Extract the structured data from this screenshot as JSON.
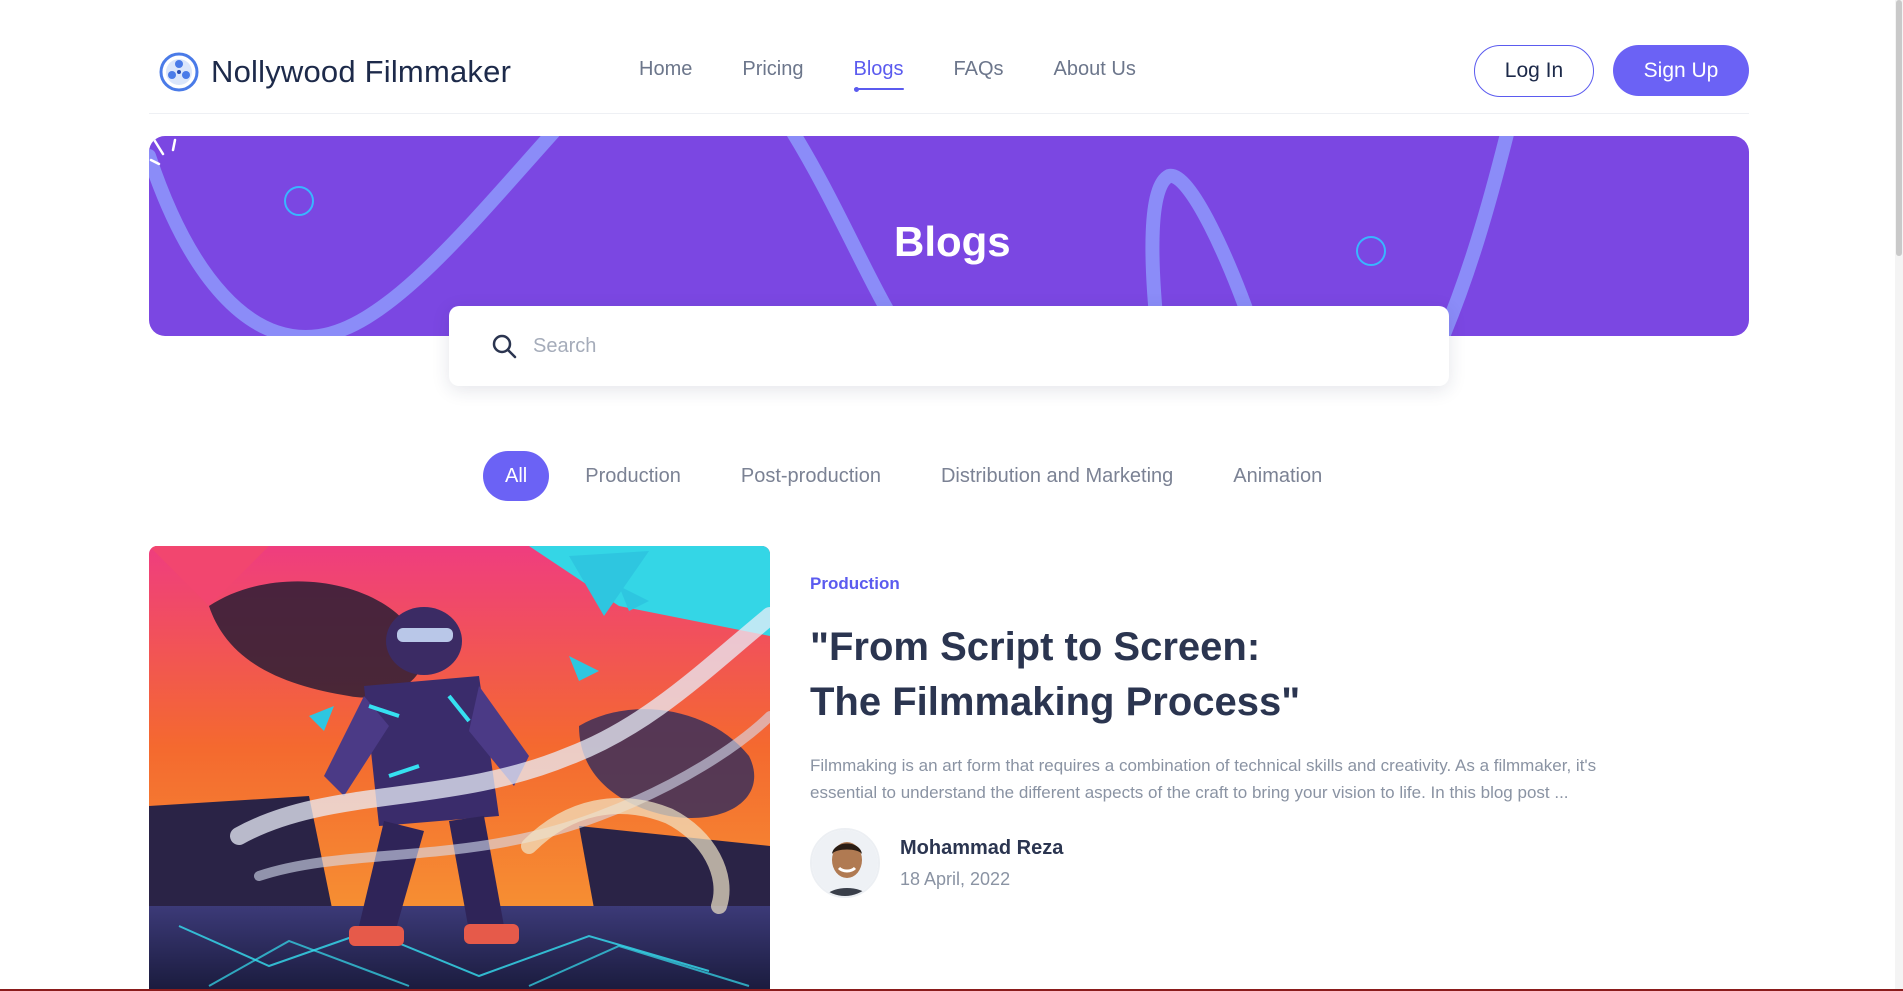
{
  "brand": {
    "name": "Nollywood Filmmaker"
  },
  "nav": {
    "items": [
      {
        "label": "Home"
      },
      {
        "label": "Pricing"
      },
      {
        "label": "Blogs",
        "active": true
      },
      {
        "label": "FAQs"
      },
      {
        "label": "About Us"
      }
    ]
  },
  "auth": {
    "login_label": "Log In",
    "signup_label": "Sign Up"
  },
  "banner": {
    "title": "Blogs"
  },
  "search": {
    "placeholder": "Search",
    "value": ""
  },
  "filters": {
    "items": [
      {
        "label": "All",
        "active": true
      },
      {
        "label": "Production"
      },
      {
        "label": "Post-production"
      },
      {
        "label": "Distribution and Marketing"
      },
      {
        "label": "Animation"
      }
    ]
  },
  "post": {
    "category": "Production",
    "title": "\"From Script to Screen: The Filmmaking Process\"",
    "excerpt": "Filmmaking is an art form that requires a combination of technical skills and creativity. As a filmmaker, it's essential to understand the different aspects of the craft to bring your vision to life. In this blog post ...",
    "author": "Mohammad Reza",
    "date": "18 April, 2022"
  },
  "colors": {
    "accent": "#6b62f5",
    "banner": "#7b47e2",
    "banner_lines": "#8b8cf8"
  },
  "icons": {
    "logo": "film-reel-icon",
    "search": "search-icon"
  }
}
